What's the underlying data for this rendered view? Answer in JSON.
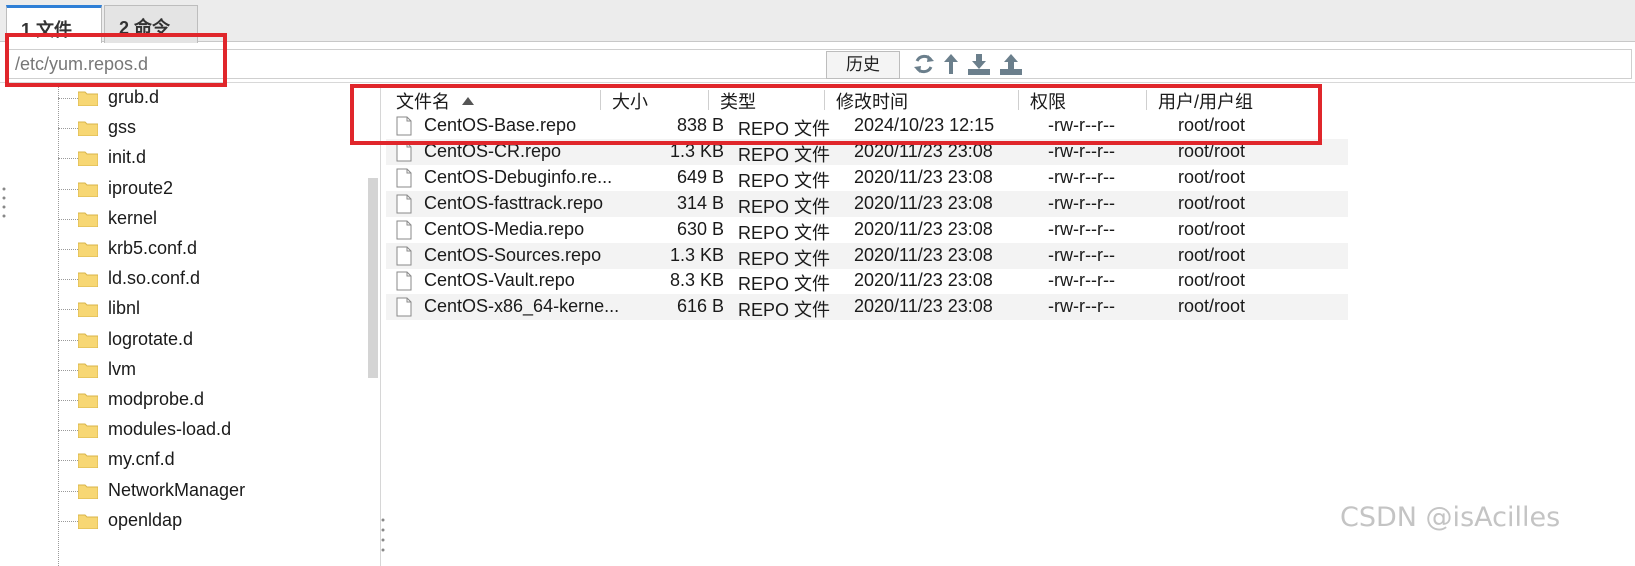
{
  "tabs": [
    {
      "label": "1 文件",
      "active": true
    },
    {
      "label": "2 命令",
      "active": false
    }
  ],
  "path_bar": {
    "value": "/etc/yum.repos.d",
    "history_label": "历史",
    "icons": [
      "refresh-icon",
      "up-arrow-icon",
      "download-icon",
      "upload-icon"
    ]
  },
  "tree": {
    "items": [
      {
        "label": "grub.d"
      },
      {
        "label": "gss"
      },
      {
        "label": "init.d"
      },
      {
        "label": "iproute2"
      },
      {
        "label": "kernel"
      },
      {
        "label": "krb5.conf.d"
      },
      {
        "label": "ld.so.conf.d"
      },
      {
        "label": "libnl"
      },
      {
        "label": "logrotate.d"
      },
      {
        "label": "lvm"
      },
      {
        "label": "modprobe.d"
      },
      {
        "label": "modules-load.d"
      },
      {
        "label": "my.cnf.d"
      },
      {
        "label": "NetworkManager"
      },
      {
        "label": "openldap"
      }
    ]
  },
  "file_table": {
    "columns": [
      "文件名",
      "大小",
      "类型",
      "修改时间",
      "权限",
      "用户/用户组"
    ],
    "sort_column": "文件名",
    "rows": [
      {
        "name": "CentOS-Base.repo",
        "size": "838 B",
        "type": "REPO 文件",
        "modified": "2024/10/23 12:15",
        "perm": "-rw-r--r--",
        "owner": "root/root"
      },
      {
        "name": "CentOS-CR.repo",
        "size": "1.3 KB",
        "type": "REPO 文件",
        "modified": "2020/11/23 23:08",
        "perm": "-rw-r--r--",
        "owner": "root/root"
      },
      {
        "name": "CentOS-Debuginfo.re...",
        "size": "649 B",
        "type": "REPO 文件",
        "modified": "2020/11/23 23:08",
        "perm": "-rw-r--r--",
        "owner": "root/root"
      },
      {
        "name": "CentOS-fasttrack.repo",
        "size": "314 B",
        "type": "REPO 文件",
        "modified": "2020/11/23 23:08",
        "perm": "-rw-r--r--",
        "owner": "root/root"
      },
      {
        "name": "CentOS-Media.repo",
        "size": "630 B",
        "type": "REPO 文件",
        "modified": "2020/11/23 23:08",
        "perm": "-rw-r--r--",
        "owner": "root/root"
      },
      {
        "name": "CentOS-Sources.repo",
        "size": "1.3 KB",
        "type": "REPO 文件",
        "modified": "2020/11/23 23:08",
        "perm": "-rw-r--r--",
        "owner": "root/root"
      },
      {
        "name": "CentOS-Vault.repo",
        "size": "8.3 KB",
        "type": "REPO 文件",
        "modified": "2020/11/23 23:08",
        "perm": "-rw-r--r--",
        "owner": "root/root"
      },
      {
        "name": "CentOS-x86_64-kerne...",
        "size": "616 B",
        "type": "REPO 文件",
        "modified": "2020/11/23 23:08",
        "perm": "-rw-r--r--",
        "owner": "root/root"
      }
    ]
  },
  "watermark": "CSDN @isAcilles",
  "colors": {
    "annotation_red": "#e0262b",
    "tab_accent": "#2f7fd6"
  }
}
